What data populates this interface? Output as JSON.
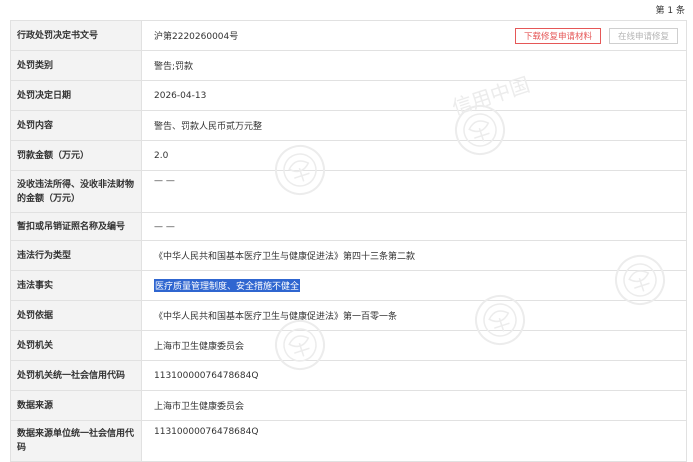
{
  "pagination": {
    "label": "第 1 条"
  },
  "buttons": {
    "download": "下载修复申请材料",
    "online": "在线申请修复"
  },
  "watermark": {
    "brand": "信用中国"
  },
  "rows": [
    {
      "label": "行政处罚决定书文号",
      "value": "沪第2220260004号"
    },
    {
      "label": "处罚类别",
      "value": "警告;罚款"
    },
    {
      "label": "处罚决定日期",
      "value": "2026-04-13"
    },
    {
      "label": "处罚内容",
      "value": "警告、罚款人民币贰万元整"
    },
    {
      "label": "罚款金额（万元）",
      "value": "2.0"
    },
    {
      "label": "没收违法所得、没收非法财物的金额（万元）",
      "value": "— —"
    },
    {
      "label": "暂扣或吊销证照名称及编号",
      "value": "— —"
    },
    {
      "label": "违法行为类型",
      "value": "《中华人民共和国基本医疗卫生与健康促进法》第四十三条第二款"
    },
    {
      "label": "违法事实",
      "value": "医疗质量管理制度、安全措施不健全"
    },
    {
      "label": "处罚依据",
      "value": "《中华人民共和国基本医疗卫生与健康促进法》第一百零一条"
    },
    {
      "label": "处罚机关",
      "value": "上海市卫生健康委员会"
    },
    {
      "label": "处罚机关统一社会信用代码",
      "value": "11310000076478684Q"
    },
    {
      "label": "数据来源",
      "value": "上海市卫生健康委员会"
    },
    {
      "label": "数据来源单位统一社会信用代码",
      "value": "11310000076478684Q"
    }
  ]
}
